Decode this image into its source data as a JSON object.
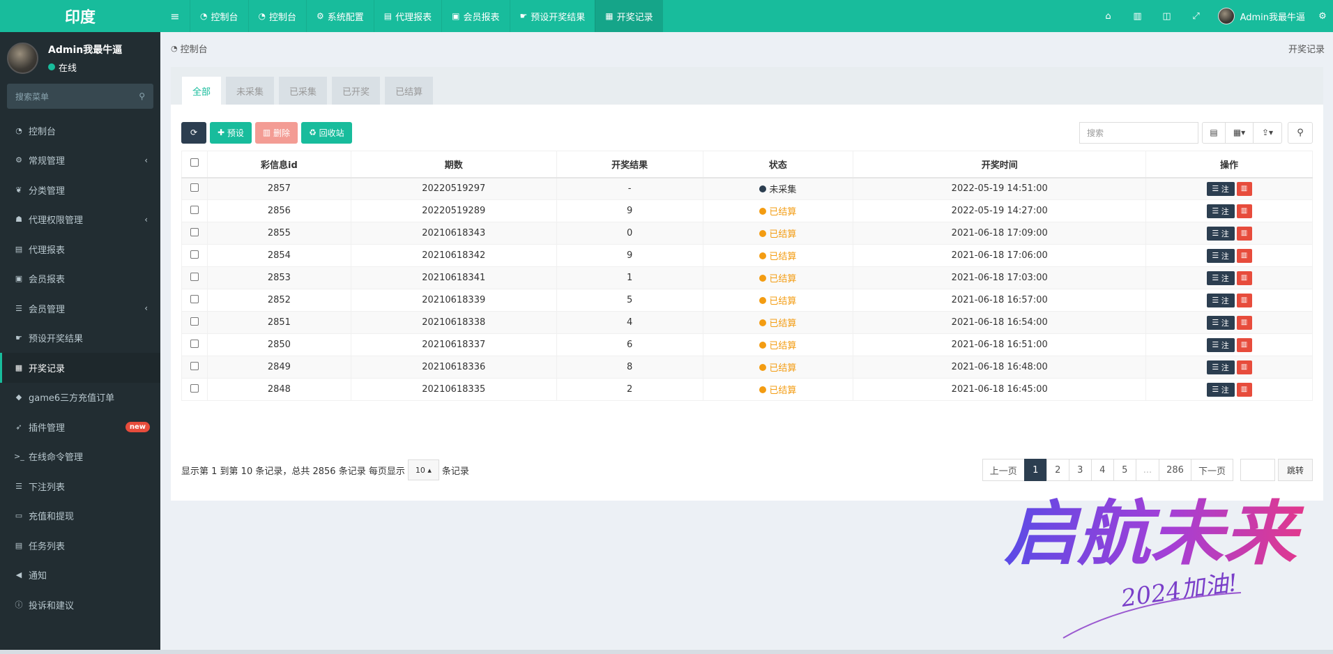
{
  "brand": "印度",
  "user": {
    "name": "Admin我最牛逼",
    "status": "在线"
  },
  "side_search_placeholder": "搜索菜单",
  "menu": [
    {
      "label": "控制台",
      "icon": "dashboard-icon",
      "glyph": "◔",
      "arrow": false
    },
    {
      "label": "常规管理",
      "icon": "cogs-icon",
      "glyph": "⚙",
      "arrow": true
    },
    {
      "label": "分类管理",
      "icon": "leaf-icon",
      "glyph": "❦",
      "arrow": false
    },
    {
      "label": "代理权限管理",
      "icon": "group-icon",
      "glyph": "☗",
      "arrow": true
    },
    {
      "label": "代理报表",
      "icon": "book-icon",
      "glyph": "▤",
      "arrow": false
    },
    {
      "label": "会员报表",
      "icon": "id-card-icon",
      "glyph": "▣",
      "arrow": false
    },
    {
      "label": "会员管理",
      "icon": "list-icon",
      "glyph": "☰",
      "arrow": true
    },
    {
      "label": "预设开奖结果",
      "icon": "hand-icon",
      "glyph": "☛",
      "arrow": false
    },
    {
      "label": "开奖记录",
      "icon": "calendar-check-icon",
      "glyph": "▦",
      "arrow": false,
      "active": true
    },
    {
      "label": "game6三方充值订单",
      "icon": "diamond-icon",
      "glyph": "◆",
      "arrow": false
    },
    {
      "label": "插件管理",
      "icon": "rocket-icon",
      "glyph": "➶",
      "arrow": false,
      "badge": "new"
    },
    {
      "label": "在线命令管理",
      "icon": "terminal-icon",
      "glyph": ">_",
      "arrow": false
    },
    {
      "label": "下注列表",
      "icon": "list-icon",
      "glyph": "☰",
      "arrow": false
    },
    {
      "label": "充值和提现",
      "icon": "money-icon",
      "glyph": "▭",
      "arrow": false
    },
    {
      "label": "任务列表",
      "icon": "book-icon",
      "glyph": "▤",
      "arrow": false
    },
    {
      "label": "通知",
      "icon": "bullhorn-icon",
      "glyph": "◀",
      "arrow": false
    },
    {
      "label": "投诉和建议",
      "icon": "info-icon",
      "glyph": "ⓘ",
      "arrow": false
    }
  ],
  "top_tabs": [
    {
      "label": "控制台",
      "icon": "dashboard-icon",
      "glyph": "◔"
    },
    {
      "label": "控制台",
      "icon": "dashboard-icon",
      "glyph": "◔"
    },
    {
      "label": "系统配置",
      "icon": "gear-icon",
      "glyph": "⚙"
    },
    {
      "label": "代理报表",
      "icon": "book-icon",
      "glyph": "▤"
    },
    {
      "label": "会员报表",
      "icon": "id-card-icon",
      "glyph": "▣"
    },
    {
      "label": "预设开奖结果",
      "icon": "hand-icon",
      "glyph": "☛"
    },
    {
      "label": "开奖记录",
      "icon": "calendar-check-icon",
      "glyph": "▦",
      "active": true
    }
  ],
  "breadcrumb": {
    "home": "控制台",
    "current": "开奖记录"
  },
  "filter_tabs": [
    "全部",
    "未采集",
    "已采集",
    "已开奖",
    "已结算"
  ],
  "toolbar": {
    "add": "预设",
    "del": "删除",
    "recycle": "回收站",
    "search_placeholder": "搜索"
  },
  "table": {
    "headers": [
      "彩信息id",
      "期数",
      "开奖结果",
      "状态",
      "开奖时间",
      "操作"
    ],
    "op_label": "注",
    "rows": [
      {
        "id": "2857",
        "issue": "20220519297",
        "result": "-",
        "status": "未采集",
        "status_type": "dark",
        "time": "2022-05-19 14:51:00"
      },
      {
        "id": "2856",
        "issue": "20220519289",
        "result": "9",
        "status": "已结算",
        "status_type": "orange",
        "time": "2022-05-19 14:27:00"
      },
      {
        "id": "2855",
        "issue": "20210618343",
        "result": "0",
        "status": "已结算",
        "status_type": "orange",
        "time": "2021-06-18 17:09:00"
      },
      {
        "id": "2854",
        "issue": "20210618342",
        "result": "9",
        "status": "已结算",
        "status_type": "orange",
        "time": "2021-06-18 17:06:00"
      },
      {
        "id": "2853",
        "issue": "20210618341",
        "result": "1",
        "status": "已结算",
        "status_type": "orange",
        "time": "2021-06-18 17:03:00"
      },
      {
        "id": "2852",
        "issue": "20210618339",
        "result": "5",
        "status": "已结算",
        "status_type": "orange",
        "time": "2021-06-18 16:57:00"
      },
      {
        "id": "2851",
        "issue": "20210618338",
        "result": "4",
        "status": "已结算",
        "status_type": "orange",
        "time": "2021-06-18 16:54:00"
      },
      {
        "id": "2850",
        "issue": "20210618337",
        "result": "6",
        "status": "已结算",
        "status_type": "orange",
        "time": "2021-06-18 16:51:00"
      },
      {
        "id": "2849",
        "issue": "20210618336",
        "result": "8",
        "status": "已结算",
        "status_type": "orange",
        "time": "2021-06-18 16:48:00"
      },
      {
        "id": "2848",
        "issue": "20210618335",
        "result": "2",
        "status": "已结算",
        "status_type": "orange",
        "time": "2021-06-18 16:45:00"
      }
    ]
  },
  "pagination": {
    "summary_before": "显示第 1 到第 10 条记录，总共 2856 条记录 每页显示",
    "page_size": "10",
    "summary_after": "条记录",
    "prev": "上一页",
    "pages": [
      "1",
      "2",
      "3",
      "4",
      "5",
      "...",
      "286"
    ],
    "next": "下一页",
    "jump": "跳转"
  },
  "watermark": {
    "main": "启航未来",
    "sub": "2024加油!"
  },
  "colors": {
    "brand": "#18bc9c",
    "sidebar": "#222d32",
    "dark": "#2c3e50",
    "danger": "#e74c3c",
    "warning": "#f39c12"
  }
}
